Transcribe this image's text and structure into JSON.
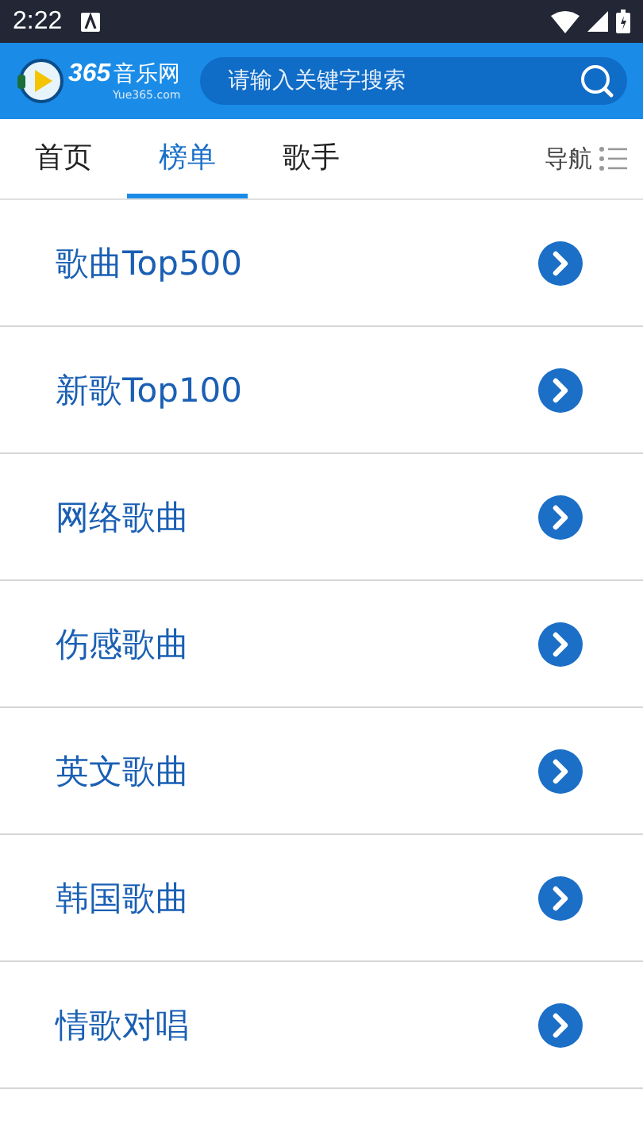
{
  "status_bar": {
    "time": "2:22"
  },
  "header": {
    "logo": {
      "brand": "365",
      "name": "音乐网",
      "site": "Yue365.com"
    },
    "search": {
      "placeholder": "请输入关键字搜索"
    }
  },
  "tabs": [
    {
      "label": "首页",
      "selected": false
    },
    {
      "label": "榜单",
      "selected": true
    },
    {
      "label": "歌手",
      "selected": false
    }
  ],
  "nav": {
    "label": "导航"
  },
  "charts": [
    {
      "title": "歌曲Top500"
    },
    {
      "title": "新歌Top100"
    },
    {
      "title": "网络歌曲"
    },
    {
      "title": "伤感歌曲"
    },
    {
      "title": "英文歌曲"
    },
    {
      "title": "韩国歌曲"
    },
    {
      "title": "情歌对唱"
    }
  ]
}
